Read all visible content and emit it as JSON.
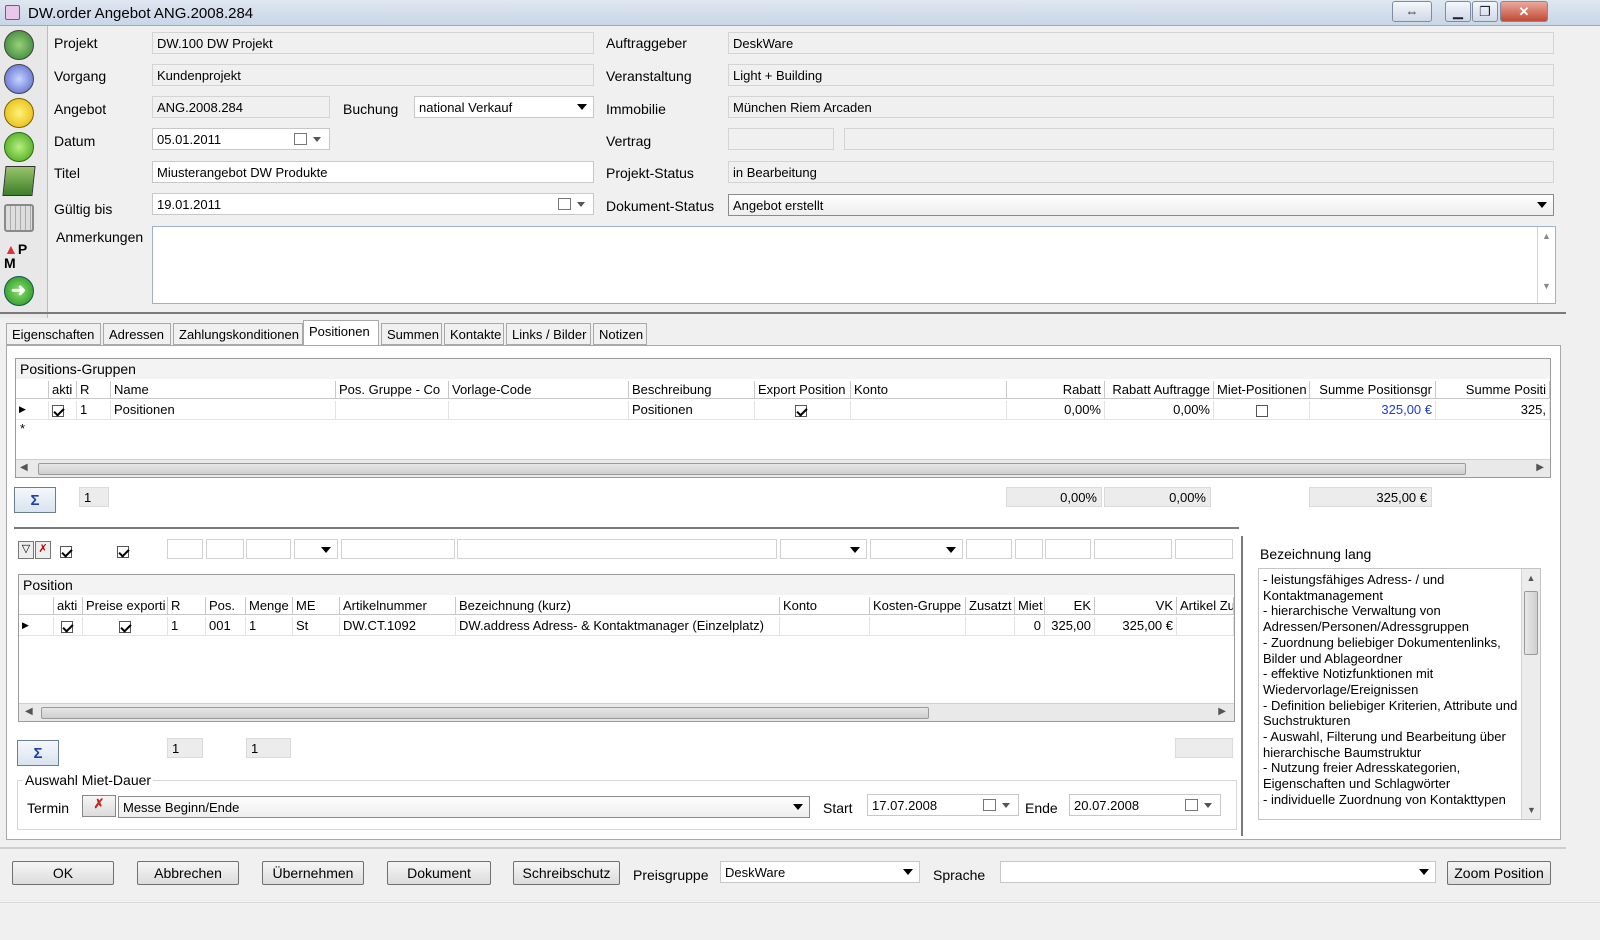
{
  "window": {
    "title": "DW.order Angebot ANG.2008.284"
  },
  "header": {
    "projekt_label": "Projekt",
    "projekt_value": "DW.100 DW Projekt",
    "vorgang_label": "Vorgang",
    "vorgang_value": "Kundenprojekt",
    "angebot_label": "Angebot",
    "angebot_value": "ANG.2008.284",
    "buchung_label": "Buchung",
    "buchung_value": "national Verkauf",
    "datum_label": "Datum",
    "datum_value": "05.01.2011",
    "titel_label": "Titel",
    "titel_value": "Miusterangebot DW Produkte",
    "gueltig_label": "Gültig bis",
    "gueltig_value": "19.01.2011",
    "anmerkungen_label": "Anmerkungen",
    "anmerkungen_value": "",
    "auftraggeber_label": "Auftraggeber",
    "auftraggeber_value": "DeskWare",
    "veranstaltung_label": "Veranstaltung",
    "veranstaltung_value": "Light + Building",
    "immobilie_label": "Immobilie",
    "immobilie_value": "München Riem Arcaden",
    "vertrag_label": "Vertrag",
    "vertrag_value": "",
    "vertrag_value2": "",
    "projektstatus_label": "Projekt-Status",
    "projektstatus_value": "in Bearbeitung",
    "dokumentstatus_label": "Dokument-Status",
    "dokumentstatus_value": "Angebot erstellt"
  },
  "tabs": [
    {
      "label": "Eigenschaften"
    },
    {
      "label": "Adressen"
    },
    {
      "label": "Zahlungskonditionen"
    },
    {
      "label": "Positionen"
    },
    {
      "label": "Summen"
    },
    {
      "label": "Kontakte"
    },
    {
      "label": "Links / Bilder"
    },
    {
      "label": "Notizen"
    }
  ],
  "groups": {
    "title": "Positions-Gruppen",
    "columns": [
      "akti",
      "R",
      "Name",
      "Pos. Gruppe - Co",
      "Vorlage-Code",
      "Beschreibung",
      "Export Position",
      "Konto",
      "Rabatt",
      "Rabatt Auftragge",
      "Miet-Positionen",
      "Summe Positionsgr",
      "Summe Positi"
    ],
    "row": {
      "R": "1",
      "name": "Positionen",
      "beschreibung": "Positionen",
      "rabatt": "0,00%",
      "rabatt_auftraggeber": "0,00%",
      "summe": "325,00 €",
      "summe2": "325,"
    },
    "new_row_marker": "*",
    "sum_count": "1",
    "sum_rabatt": "0,00%",
    "sum_rabatt_auftraggeber": "0,00%",
    "sum_summe": "325,00 €",
    "sum_symbol": "Σ"
  },
  "positions": {
    "title": "Position",
    "columns": [
      "akti",
      "Preise exporti",
      "R",
      "Pos.",
      "Menge",
      "ME",
      "Artikelnummer",
      "Bezeichnung (kurz)",
      "Konto",
      "Kosten-Gruppe",
      "Zusatzt",
      "Miet",
      "EK",
      "VK",
      "Artikel Zu"
    ],
    "row": {
      "R": "1",
      "pos": "001",
      "menge": "1",
      "me": "St",
      "artikelnummer": "DW.CT.1092",
      "bezeichnung": "DW.address Adress- & Kontaktmanager (Einzelplatz)",
      "miet": "0",
      "ek": "325,00",
      "vk": "325,00 €"
    },
    "sum_count_r": "1",
    "sum_count_menge": "1",
    "sum_symbol": "Σ"
  },
  "miet": {
    "title": "Auswahl Miet-Dauer",
    "termin_label": "Termin",
    "termin_value": "Messe Beginn/Ende",
    "start_label": "Start",
    "start_value": "17.07.2008",
    "ende_label": "Ende",
    "ende_value": "20.07.2008"
  },
  "bezeichnung_lang": {
    "title": "Bezeichnung lang",
    "lines": [
      "- leistungsfähiges Adress- / und",
      "Kontaktmanagement",
      "- hierarchische Verwaltung von",
      "Adressen/Personen/Adressgruppen",
      "- Zuordnung beliebiger Dokumentenlinks,",
      "Bilder und Ablageordner",
      "- effektive Notizfunktionen mit",
      "Wiedervorlage/Ereignissen",
      "- Definition beliebiger Kriterien, Attribute und",
      "Suchstrukturen",
      "- Auswahl, Filterung und Bearbeitung über",
      "hierarchische Baumstruktur",
      "- Nutzung freier Adresskategorien,",
      "Eigenschaften und Schlagwörter",
      "- individuelle Zuordnung von Kontakttypen"
    ]
  },
  "footer": {
    "ok": "OK",
    "abbrechen": "Abbrechen",
    "uebernehmen": "Übernehmen",
    "dokument": "Dokument",
    "schreibschutz": "Schreibschutz",
    "preisgruppe_label": "Preisgruppe",
    "preisgruppe_value": "DeskWare",
    "sprache_label": "Sprache",
    "sprache_value": "",
    "zoom": "Zoom Position"
  },
  "toolbar_icons": {
    "ribbon_top": "P",
    "ribbon_bottom": "M"
  }
}
